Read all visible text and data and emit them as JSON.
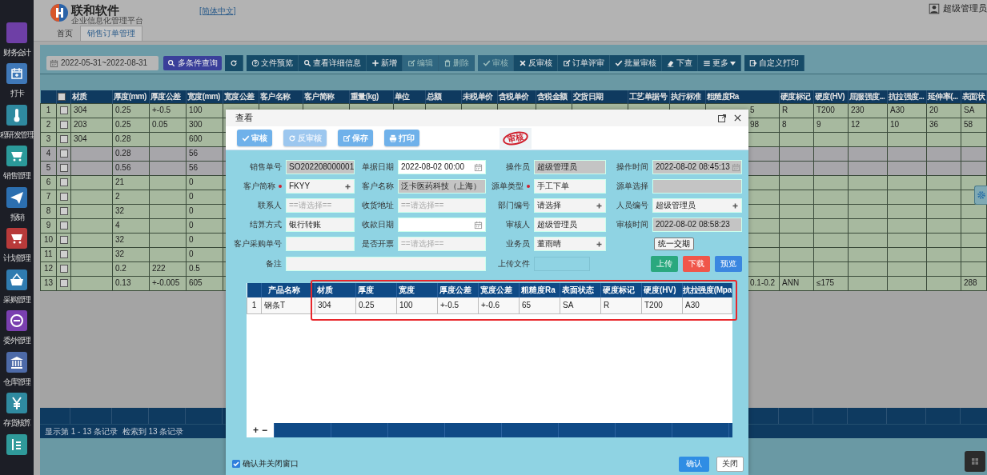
{
  "sidebar": {
    "items": [
      {
        "label": "财务会计",
        "color": "#6e3fa6"
      },
      {
        "label": "打卡",
        "color": "#3f78b8"
      },
      {
        "label": "程研发管理",
        "color": "#2f8aa0"
      },
      {
        "label": "销售管理",
        "color": "#2b9a9a"
      },
      {
        "label": "报销",
        "color": "#2c6fb0"
      },
      {
        "label": "计划管理",
        "color": "#b83a3a"
      },
      {
        "label": "采购管理",
        "color": "#2f7bb0"
      },
      {
        "label": "委外管理",
        "color": "#7a3fb0"
      },
      {
        "label": "仓库管理",
        "color": "#4d6aa8"
      },
      {
        "label": "存货核算",
        "color": "#2f8aa0"
      },
      {
        "color": "#2f9a9a"
      }
    ]
  },
  "header": {
    "brand": "联和软件",
    "subtitle": "企业信息化管理平台",
    "language": "[简体中文]",
    "user": "超级管理员"
  },
  "tabs": [
    {
      "label": "首页",
      "selected": false
    },
    {
      "label": "销售订单管理",
      "selected": true
    }
  ],
  "toolbar": {
    "date_range": "2022-05-31~2022-08-31",
    "search_button": "多条件查询",
    "groups": [
      [
        {
          "kind": "refresh",
          "disabled": false
        }
      ],
      [
        {
          "kind": "preview",
          "label": "文件预览",
          "disabled": false
        },
        {
          "kind": "search",
          "label": "查看详细信息",
          "disabled": false
        },
        {
          "kind": "add",
          "label": "新增",
          "disabled": false
        },
        {
          "kind": "edit",
          "label": "编辑",
          "disabled": true
        },
        {
          "kind": "delete",
          "label": "删除",
          "disabled": true
        }
      ],
      [
        {
          "kind": "approve",
          "label": "审核",
          "disabled": true
        },
        {
          "kind": "reject",
          "label": "反审核",
          "disabled": false
        },
        {
          "kind": "edit",
          "label": "订单评审",
          "disabled": false
        },
        {
          "kind": "approve",
          "label": "批量审核",
          "disabled": false
        },
        {
          "kind": "erase",
          "label": "下查",
          "disabled": false
        },
        {
          "kind": "more",
          "label": "更多",
          "disabled": false
        }
      ],
      [
        {
          "kind": "print",
          "label": "自定义打印",
          "disabled": false
        }
      ]
    ]
  },
  "table": {
    "select_all": {
      "checked": false
    },
    "columns": [
      "材质",
      "厚度(mm)",
      "厚度公差",
      "宽度(mm)",
      "宽度公差",
      "客户名称",
      "客户简称",
      "重量(kg)",
      "单位",
      "总额",
      "未税单价",
      "含税单价",
      "含税金额",
      "交货日期",
      "工艺单据号",
      "执行标准",
      "粗糙度Ra",
      "硬度标记",
      "硬度(HV)",
      "屈服强度...",
      "抗拉强度...",
      "延伸率(...",
      "表面状"
    ],
    "rows": [
      {
        "no": "1",
        "checked": false,
        "dimmed": false,
        "cells": [
          "304",
          "0.25",
          "+-0.5",
          "100",
          null,
          null,
          null,
          null,
          null,
          null,
          null,
          null,
          null,
          null,
          null,
          null,
          "5",
          "R",
          "T200",
          "230",
          "A30",
          "20",
          "SA"
        ]
      },
      {
        "no": "2",
        "checked": false,
        "dimmed": false,
        "cells": [
          "203",
          "0.25",
          "0.05",
          "300",
          null,
          null,
          null,
          null,
          null,
          null,
          null,
          null,
          null,
          null,
          null,
          null,
          "98",
          "8",
          "9",
          "12",
          "10",
          "36",
          "58"
        ]
      },
      {
        "no": "3",
        "checked": false,
        "dimmed": false,
        "cells": [
          "304",
          "0.28",
          null,
          "600",
          null,
          null,
          null,
          null,
          null,
          null,
          null,
          null,
          null,
          null,
          null,
          null,
          null,
          null,
          null,
          null,
          null,
          null,
          null
        ]
      },
      {
        "no": "4",
        "checked": false,
        "dimmed": true,
        "cells": [
          null,
          "0.28",
          null,
          "56",
          null,
          null,
          null,
          null,
          null,
          null,
          null,
          null,
          null,
          null,
          null,
          null,
          null,
          null,
          null,
          null,
          null,
          null,
          null
        ]
      },
      {
        "no": "5",
        "checked": false,
        "dimmed": true,
        "cells": [
          null,
          "0.56",
          null,
          "56",
          null,
          null,
          null,
          null,
          null,
          null,
          null,
          null,
          null,
          null,
          null,
          null,
          null,
          null,
          null,
          null,
          null,
          null,
          null
        ]
      },
      {
        "no": "6",
        "checked": false,
        "dimmed": false,
        "cells": [
          null,
          "21",
          null,
          "0",
          null,
          null,
          null,
          null,
          null,
          null,
          null,
          null,
          null,
          null,
          null,
          null,
          null,
          null,
          null,
          null,
          null,
          null,
          null
        ]
      },
      {
        "no": "7",
        "checked": false,
        "dimmed": false,
        "cells": [
          null,
          "2",
          null,
          "0",
          null,
          null,
          null,
          null,
          null,
          null,
          null,
          null,
          null,
          null,
          null,
          null,
          null,
          null,
          null,
          null,
          null,
          null,
          null
        ]
      },
      {
        "no": "8",
        "checked": false,
        "dimmed": false,
        "cells": [
          null,
          "32",
          null,
          "0",
          null,
          null,
          null,
          null,
          null,
          null,
          null,
          null,
          null,
          null,
          null,
          null,
          null,
          null,
          null,
          null,
          null,
          null,
          null
        ]
      },
      {
        "no": "9",
        "checked": false,
        "dimmed": false,
        "cells": [
          null,
          "4",
          null,
          "0",
          null,
          null,
          null,
          null,
          null,
          null,
          null,
          null,
          null,
          null,
          null,
          null,
          null,
          null,
          null,
          null,
          null,
          null,
          null
        ]
      },
      {
        "no": "10",
        "checked": false,
        "dimmed": false,
        "cells": [
          null,
          "32",
          null,
          "0",
          null,
          null,
          null,
          null,
          null,
          null,
          null,
          null,
          null,
          null,
          null,
          null,
          null,
          null,
          null,
          null,
          null,
          null,
          null
        ]
      },
      {
        "no": "11",
        "checked": false,
        "dimmed": false,
        "cells": [
          null,
          "32",
          null,
          "0",
          null,
          null,
          null,
          null,
          null,
          null,
          null,
          null,
          null,
          null,
          null,
          null,
          null,
          null,
          null,
          null,
          null,
          null,
          null
        ]
      },
      {
        "no": "12",
        "checked": false,
        "dimmed": false,
        "cells": [
          null,
          "0.2",
          "222",
          "0.5",
          null,
          null,
          null,
          null,
          null,
          null,
          null,
          null,
          null,
          null,
          null,
          null,
          null,
          null,
          null,
          null,
          null,
          null,
          null
        ]
      },
      {
        "no": "13",
        "checked": false,
        "dimmed": false,
        "cells": [
          null,
          "0.13",
          "+-0.005",
          "605",
          null,
          null,
          null,
          null,
          null,
          null,
          null,
          null,
          null,
          null,
          null,
          null,
          "0.1-0.2",
          "ANN",
          "≤175",
          null,
          null,
          null,
          "288"
        ]
      }
    ],
    "status": "显示第 1 - 13 条记录  检索到 13 条记录"
  },
  "modal": {
    "title": "查看",
    "toolbar": [
      {
        "kind": "approve",
        "label": "审核",
        "disabled": false
      },
      {
        "kind": "refresh",
        "label": "反审核",
        "disabled": true
      },
      {
        "kind": "edit",
        "label": "保存",
        "disabled": false
      },
      {
        "kind": "print",
        "label": "打印",
        "disabled": false
      }
    ],
    "stamp": "审核",
    "fields": [
      {
        "kind": "input",
        "label": "销售单号",
        "value": "SO202208000001",
        "readonly": true
      },
      {
        "kind": "input",
        "label": "单据日期",
        "value": "2022-08-02 00:00",
        "date_picker": true
      },
      {
        "kind": "input",
        "label": "操作员",
        "value": "超级管理员",
        "readonly": true
      },
      {
        "kind": "input",
        "label": "操作时间",
        "value": "2022-08-02 08:45:13",
        "readonly": true,
        "date_picker": true
      },
      {
        "kind": "input",
        "label": "客户简称",
        "required": true,
        "value": "FKYY",
        "lookup": true
      },
      {
        "kind": "input",
        "label": "客户名称",
        "value": "泛卡医药科技（上海）",
        "readonly": true
      },
      {
        "kind": "input",
        "label": "源单类型",
        "required": true,
        "value": "手工下单"
      },
      {
        "kind": "input",
        "label": "源单选择",
        "readonly": true
      },
      {
        "kind": "input",
        "label": "联系人",
        "placeholder": "==请选择=="
      },
      {
        "kind": "input",
        "label": "收货地址",
        "placeholder": "==请选择=="
      },
      {
        "kind": "input",
        "label": "部门编号",
        "value": "请选择",
        "lookup": true
      },
      {
        "kind": "input",
        "label": "人员编号",
        "value": "超级管理员",
        "lookup": true
      },
      {
        "kind": "input",
        "label": "结算方式",
        "value": "银行转账"
      },
      {
        "kind": "input",
        "label": "收款日期",
        "date_picker": true
      },
      {
        "kind": "input",
        "label": "审核人",
        "value": "超级管理员"
      },
      {
        "kind": "input",
        "label": "审核时间",
        "value": "2022-08-02 08:58:23",
        "readonly": true
      },
      {
        "kind": "input",
        "label": "客户采购单号"
      },
      {
        "kind": "input",
        "label": "是否开票",
        "placeholder": "==请选择=="
      },
      {
        "kind": "input",
        "label": "业务员",
        "value": "董雨晴",
        "lookup": true
      },
      {
        "kind": "action",
        "label": "统一交期"
      },
      {
        "kind": "note",
        "label": "备注"
      },
      {
        "kind": "upload",
        "label": "上传文件",
        "buttons": [
          {
            "label": "上传",
            "color": "#2aa87e"
          },
          {
            "label": "下载",
            "color": "#f0564a"
          },
          {
            "label": "预览",
            "color": "#3a86e0"
          }
        ]
      }
    ],
    "grid": {
      "columns": [
        "产品名称",
        "材质",
        "厚度",
        "宽度",
        "厚度公差",
        "宽度公差",
        "粗糙度Ra",
        "表面状态",
        "硬度标记",
        "硬度(HV)",
        "抗拉强度(Mpa"
      ],
      "rows": [
        {
          "no": "1",
          "cells": [
            "钢条T",
            "304",
            "0.25",
            "100",
            "+-0.5",
            "+-0.6",
            "65",
            "SA",
            "R",
            "T200",
            "A30"
          ]
        }
      ],
      "add": "+",
      "remove": "−"
    },
    "confirm_close": {
      "label": "确认并关闭窗口",
      "checked": true
    },
    "buttons": [
      {
        "label": "确认",
        "primary": true
      },
      {
        "label": "关闭",
        "primary": false
      }
    ]
  }
}
